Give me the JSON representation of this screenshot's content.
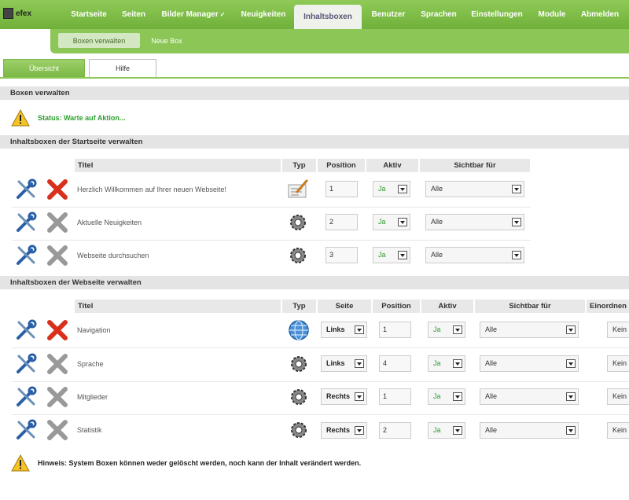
{
  "app": {
    "logo_text": "efex"
  },
  "nav": [
    "Startseite",
    "Seiten",
    "Bilder Manager",
    "Neuigkeiten",
    "Inhaltsboxen",
    "Benutzer",
    "Sprachen",
    "Einstellungen",
    "Module",
    "Abmelden"
  ],
  "nav_active": "Inhaltsboxen",
  "subnav": [
    "Boxen verwalten",
    "Neue Box"
  ],
  "tabs": [
    "Übersicht",
    "Hilfe"
  ],
  "page_title": "Boxen verwalten",
  "status": "Status: Warte auf Aktion...",
  "section1": {
    "title": "Inhaltsboxen der Startseite verwalten",
    "headers": [
      "Titel",
      "Typ",
      "Position",
      "Aktiv",
      "Sichtbar für"
    ],
    "rows": [
      {
        "title": "Herzlich Willkommen auf Ihrer neuen Webseite!",
        "type": "text",
        "deletable": true,
        "position": "1",
        "aktiv": "Ja",
        "sichtbar": "Alle"
      },
      {
        "title": "Aktuelle Neuigkeiten",
        "type": "system",
        "deletable": false,
        "position": "2",
        "aktiv": "Ja",
        "sichtbar": "Alle"
      },
      {
        "title": "Webseite durchsuchen",
        "type": "system",
        "deletable": false,
        "position": "3",
        "aktiv": "Ja",
        "sichtbar": "Alle"
      }
    ]
  },
  "section2": {
    "title": "Inhaltsboxen der Webseite verwalten",
    "headers": [
      "Titel",
      "Typ",
      "Seite",
      "Position",
      "Aktiv",
      "Sichtbar für",
      "Einordnen"
    ],
    "rows": [
      {
        "title": "Navigation",
        "type": "globe",
        "deletable": true,
        "seite": "Links",
        "position": "1",
        "aktiv": "Ja",
        "sichtbar": "Alle",
        "einordnen": "Kein"
      },
      {
        "title": "Sprache",
        "type": "system",
        "deletable": false,
        "seite": "Links",
        "position": "4",
        "aktiv": "Ja",
        "sichtbar": "Alle",
        "einordnen": "Kein"
      },
      {
        "title": "Mitglieder",
        "type": "system",
        "deletable": false,
        "seite": "Rechts",
        "position": "1",
        "aktiv": "Ja",
        "sichtbar": "Alle",
        "einordnen": "Kein"
      },
      {
        "title": "Statistik",
        "type": "system",
        "deletable": false,
        "seite": "Rechts",
        "position": "2",
        "aktiv": "Ja",
        "sichtbar": "Alle",
        "einordnen": "Kein"
      }
    ]
  },
  "hint": "Hinweis: System Boxen können weder gelöscht werden, noch kann der Inhalt verändert werden.",
  "colors": {
    "nav_green": "#7ab844",
    "status_green": "#2d9e2d",
    "delete_red": "#d9301c"
  }
}
